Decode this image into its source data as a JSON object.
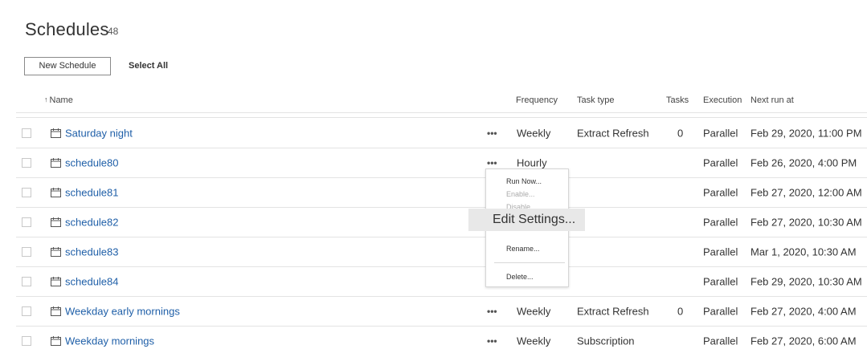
{
  "header": {
    "title": "Schedules",
    "count": "48"
  },
  "toolbar": {
    "new_schedule_label": "New Schedule",
    "select_all_label": "Select All"
  },
  "columns": {
    "name": "Name",
    "frequency": "Frequency",
    "task_type": "Task type",
    "tasks": "Tasks",
    "execution": "Execution",
    "next_run_at": "Next run at"
  },
  "rows": [
    {
      "name": "Saturday night",
      "more": "•••",
      "frequency": "Weekly",
      "task_type": "Extract Refresh",
      "tasks": "0",
      "execution": "Parallel",
      "next_run": "Feb 29, 2020, 11:00 PM"
    },
    {
      "name": "schedule80",
      "more": "•••",
      "frequency": "Hourly",
      "task_type": "",
      "tasks": "",
      "execution": "Parallel",
      "next_run": "Feb 26, 2020, 4:00 PM"
    },
    {
      "name": "schedule81",
      "more": "",
      "frequency": "",
      "task_type": "",
      "tasks": "",
      "execution": "Parallel",
      "next_run": "Feb 27, 2020, 12:00 AM"
    },
    {
      "name": "schedule82",
      "more": "",
      "frequency": "",
      "task_type": "",
      "tasks": "",
      "execution": "Parallel",
      "next_run": "Feb 27, 2020, 10:30 AM"
    },
    {
      "name": "schedule83",
      "more": "",
      "frequency": "",
      "task_type": "",
      "tasks": "",
      "execution": "Parallel",
      "next_run": "Mar 1, 2020, 10:30 AM"
    },
    {
      "name": "schedule84",
      "more": "",
      "frequency": "",
      "task_type": "",
      "tasks": "",
      "execution": "Parallel",
      "next_run": "Feb 29, 2020, 10:30 AM"
    },
    {
      "name": "Weekday early mornings",
      "more": "•••",
      "frequency": "Weekly",
      "task_type": "Extract Refresh",
      "tasks": "0",
      "execution": "Parallel",
      "next_run": "Feb 27, 2020, 4:00 AM"
    },
    {
      "name": "Weekday mornings",
      "more": "•••",
      "frequency": "Weekly",
      "task_type": "Subscription",
      "tasks": "",
      "execution": "Parallel",
      "next_run": "Feb 27, 2020, 6:00 AM"
    }
  ],
  "context_menu": {
    "run_now": "Run Now...",
    "enable": "Enable...",
    "disable": "Disable...",
    "edit_settings": "Edit Settings...",
    "rename": "Rename...",
    "delete": "Delete..."
  },
  "colors": {
    "link": "#1f5fa8",
    "hover_bg": "#e8e8e8"
  },
  "icons": {
    "row_icon": "calendar-icon",
    "sort": "sort-ascending-icon",
    "more": "more-options-icon"
  }
}
